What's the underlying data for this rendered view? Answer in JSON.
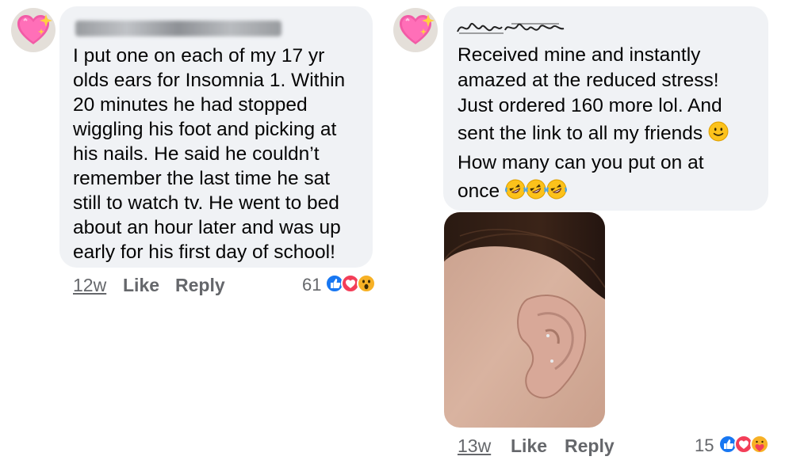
{
  "comments": [
    {
      "author": "",
      "text": "I put one on each of my 17 yr olds ears for Insomnia 1.  Within 20 minutes he had stopped wiggling his foot and picking at his nails.  He said he couldn’t remember the last time he sat still to watch tv.  He went to bed about an hour later and was up early for his first day of school!",
      "lines": [
        "I put one on each of my 17 yr",
        "olds ears for Insomnia 1.  Within",
        "20 minutes he had stopped",
        "wiggling his foot and picking at",
        "his nails.  He said he couldn’t",
        "remember the last time he sat",
        "still to watch tv.  He went to bed",
        "about an hour later and was up",
        "early for his first day of school!"
      ],
      "time": "12w",
      "like_label": "Like",
      "reply_label": "Reply",
      "reaction_count": "61",
      "reactions": [
        "like-icon",
        "love-icon",
        "wow-icon"
      ]
    },
    {
      "author": "",
      "lines": [
        "Received mine and instantly",
        "amazed at the reduced stress!",
        "Just ordered 160 more lol.  And",
        "sent the link to all my friends",
        "How many can you put on at",
        "once"
      ],
      "inline_emojis": [
        "slightly-smiling-face-icon",
        "rolling-laughing-face-icon",
        "rolling-laughing-face-icon",
        "rolling-laughing-face-icon"
      ],
      "time": "13w",
      "like_label": "Like",
      "reply_label": "Reply",
      "reaction_count": "15",
      "reactions": [
        "like-icon",
        "love-icon",
        "care-icon"
      ]
    }
  ],
  "colors": {
    "bubble": "#f0f2f5",
    "meta_text": "#65676b",
    "like_blue": "#1877f2",
    "love_red": "#f33e58",
    "wow_yellow": "#f7b125"
  }
}
